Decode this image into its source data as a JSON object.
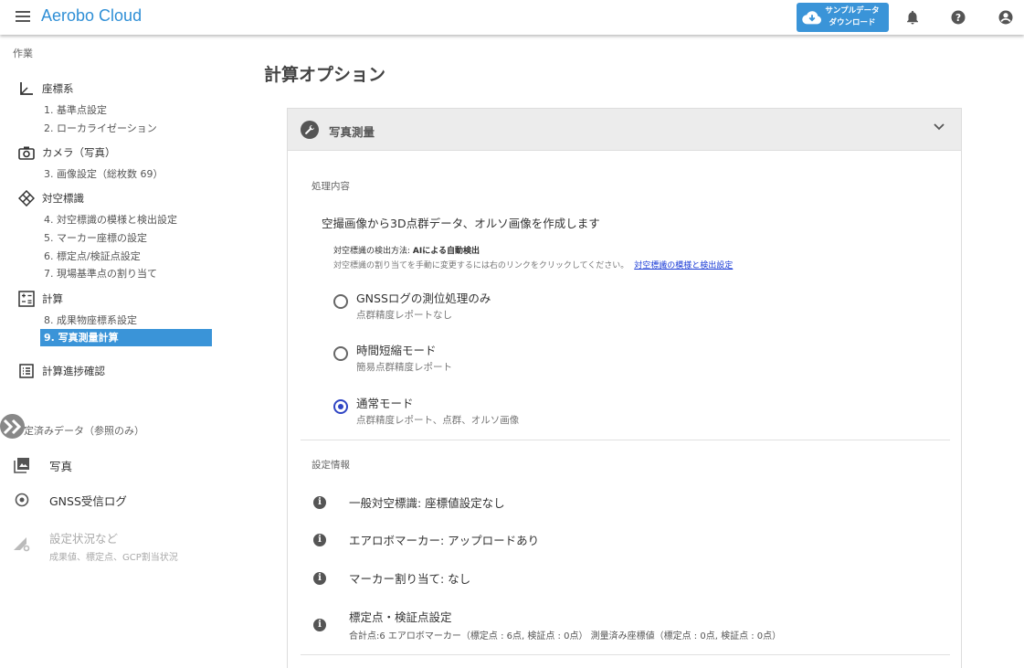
{
  "header": {
    "title": "Aerobo Cloud",
    "download_line1": "サンプルデータ",
    "download_line2": "ダウンロード"
  },
  "sidebar": {
    "section_work": "作業",
    "groups": {
      "coord": {
        "label": "座標系",
        "subs": [
          "1. 基準点設定",
          "2. ローカライゼーション"
        ]
      },
      "camera": {
        "label": "カメラ（写真）",
        "subs": [
          "3. 画像設定（総枚数 69）"
        ]
      },
      "marker": {
        "label": "対空標識",
        "subs": [
          "4. 対空標識の模様と検出設定",
          "5. マーカー座標の設定",
          "6. 標定点/検証点設定",
          "7. 現場基準点の割り当て"
        ]
      },
      "calc": {
        "label": "計算",
        "subs": [
          "8. 成果物座標系設定",
          "9. 写真測量計算"
        ]
      },
      "progress": {
        "label": "計算進捗確認"
      }
    },
    "section_data": "定済みデータ（参照のみ）",
    "items": {
      "photo": "写真",
      "gnss": "GNSS受信ログ",
      "settings": "設定状況など",
      "settings_sub": "成果値、標定点、GCP割当状況"
    }
  },
  "main": {
    "page_title": "計算オプション",
    "panel_title": "写真測量",
    "process_label": "処理内容",
    "process_desc": "空撮画像から3D点群データ、オルソ画像を作成します",
    "detect_label": "対空標識の検出方法: ",
    "detect_value": "AIによる自動検出",
    "detect_note": "対空標識の割り当てを手動に変更するには右のリンクをクリックしてください。",
    "detect_link": "対空標識の模様と検出設定",
    "options": [
      {
        "title": "GNSSログの測位処理のみ",
        "sub": "点群精度レポートなし",
        "selected": false
      },
      {
        "title": "時間短縮モード",
        "sub": "簡易点群精度レポート",
        "selected": false
      },
      {
        "title": "通常モード",
        "sub": "点群精度レポート、点群、オルソ画像",
        "selected": true
      }
    ],
    "settings_label": "設定情報",
    "info": [
      {
        "text": "一般対空標識: 座標値設定なし"
      },
      {
        "text": "エアロボマーカー: アップロードあり"
      },
      {
        "text": "マーカー割り当て: なし"
      },
      {
        "text": "標定点・検証点設定",
        "sub": "合計点:6 エアロボマーカー（標定点 : 6点, 検証点 : 0点） 測量済み座標値（標定点 : 0点, 検証点 : 0点）"
      }
    ]
  },
  "colors": {
    "accent": "#3a94d8",
    "radio": "#2f45c4",
    "link": "#1a3bd6"
  }
}
